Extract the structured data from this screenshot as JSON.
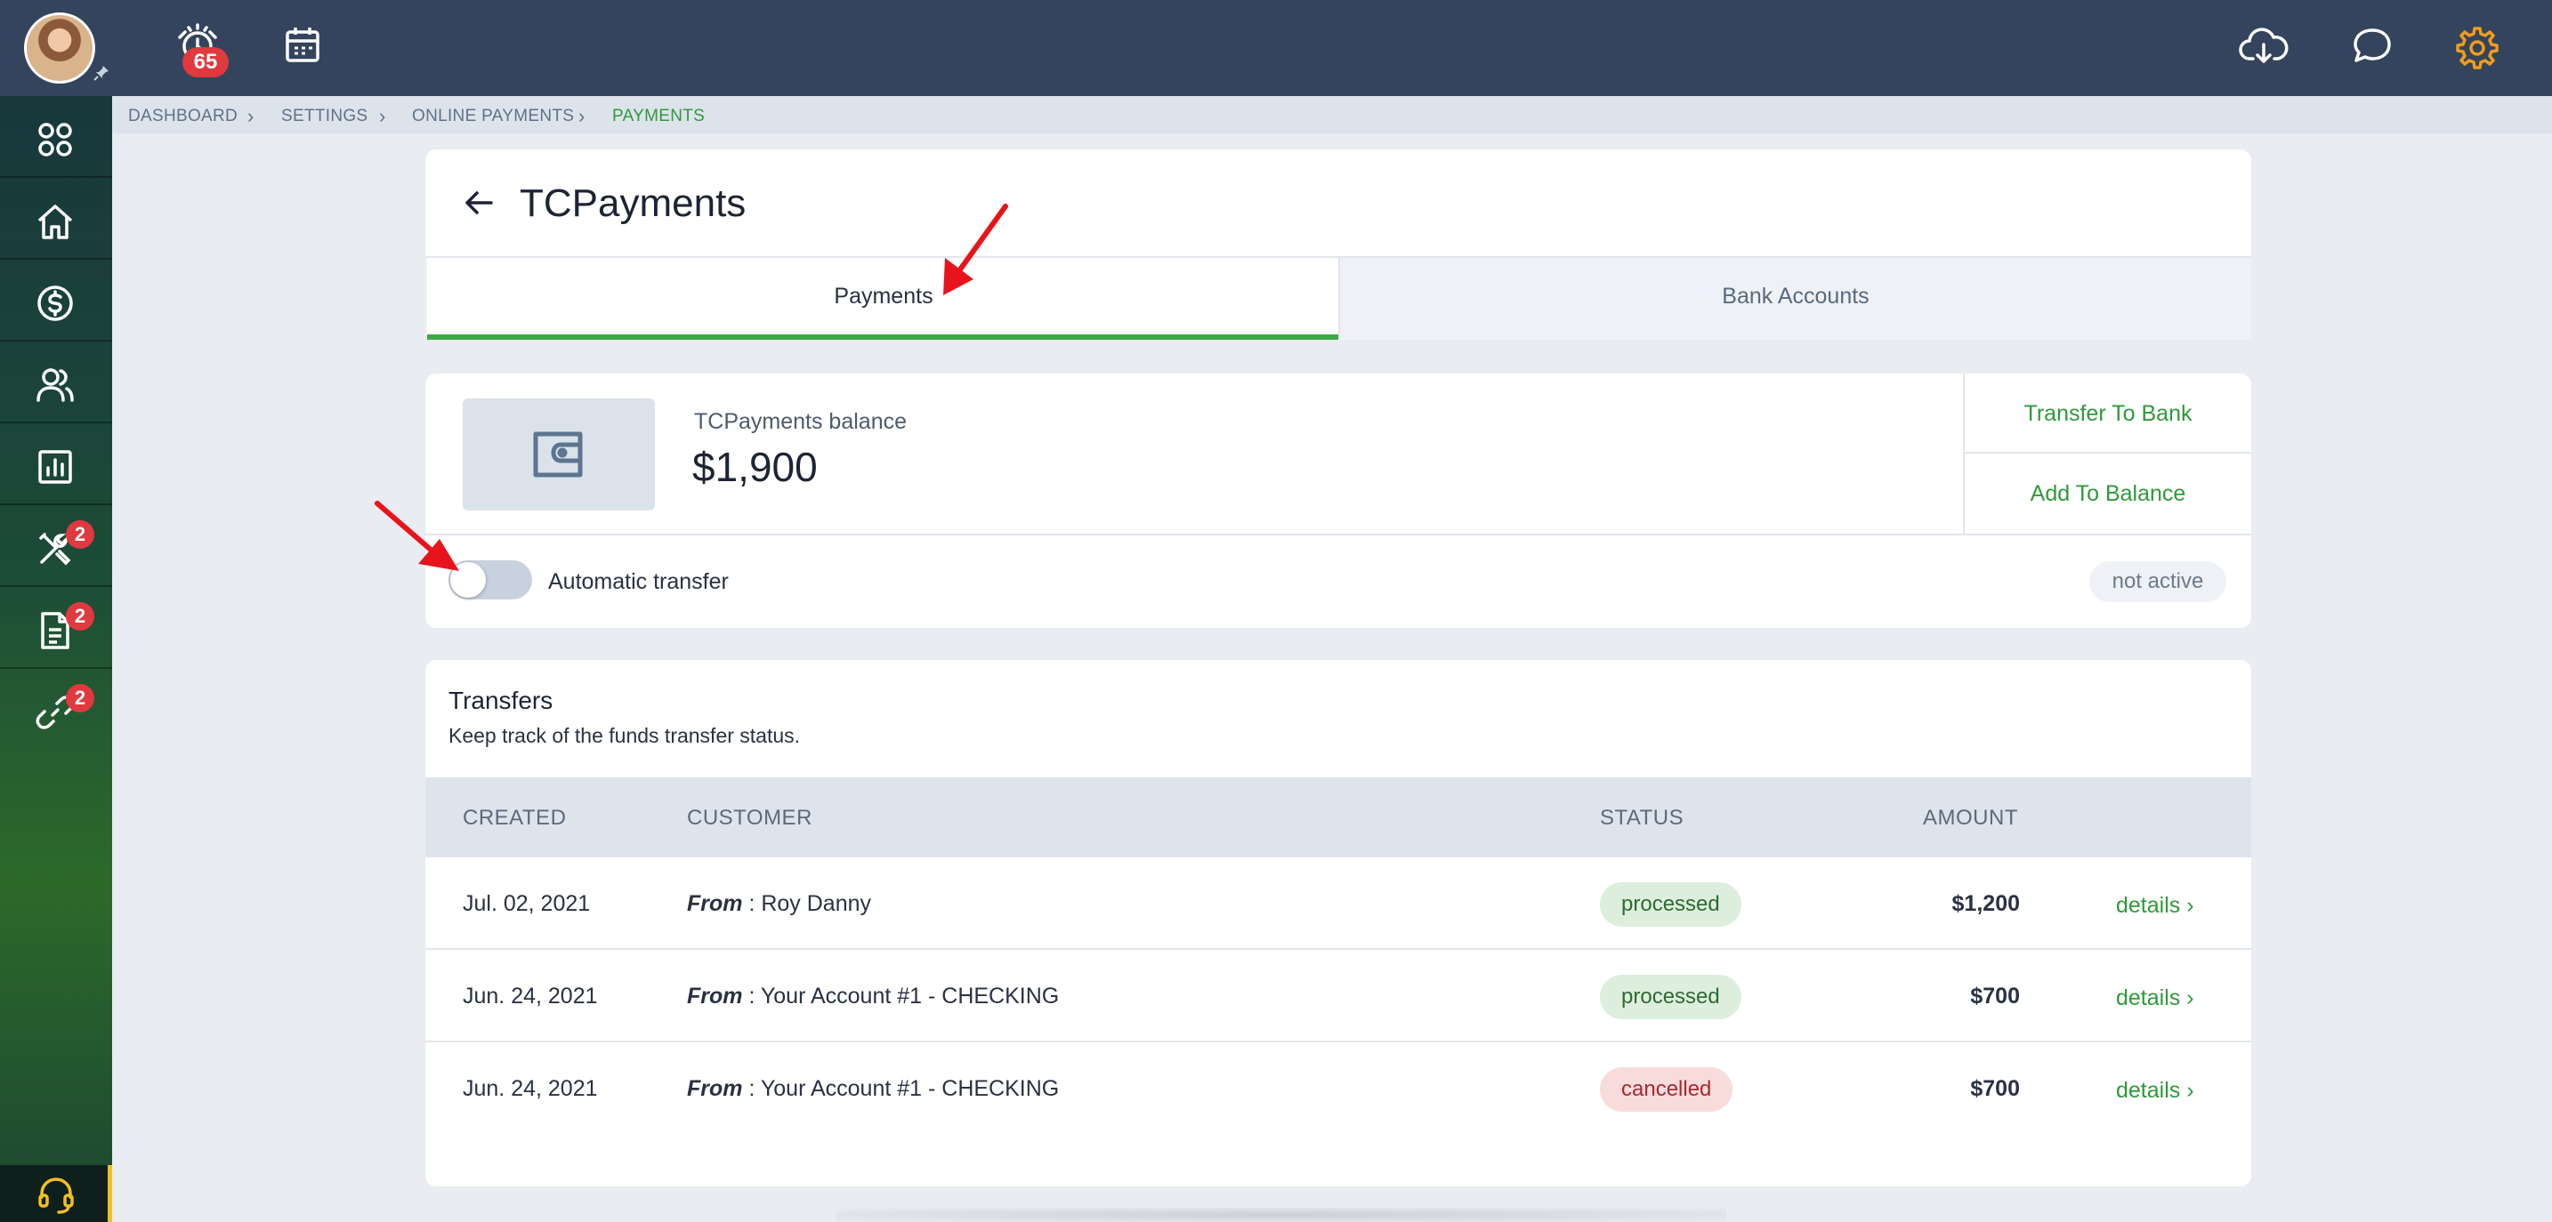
{
  "topbar": {
    "alarm_badge": "65",
    "icons": [
      "alarm-clock-icon",
      "calendar-icon",
      "cloud-download-icon",
      "chat-icon",
      "gear-icon"
    ],
    "accent_gear_color": "#f29b1d"
  },
  "sidebar": {
    "items": [
      {
        "name": "apps-grid-icon"
      },
      {
        "name": "home-icon"
      },
      {
        "name": "dollar-icon"
      },
      {
        "name": "users-icon"
      },
      {
        "name": "reports-icon"
      },
      {
        "name": "tools-icon",
        "badge": "2"
      },
      {
        "name": "document-icon",
        "badge": "2"
      },
      {
        "name": "link-icon",
        "badge": "2"
      }
    ],
    "support_icon": "headset-icon"
  },
  "breadcrumb": {
    "items": [
      "DASHBOARD",
      "SETTINGS",
      "ONLINE PAYMENTS",
      "PAYMENTS"
    ]
  },
  "header": {
    "title": "TCPayments"
  },
  "tabs": [
    {
      "label": "Payments",
      "active": true
    },
    {
      "label": "Bank Accounts",
      "active": false
    }
  ],
  "balance": {
    "label": "TCPayments balance",
    "amount": "$1,900",
    "transfer_button": "Transfer To Bank",
    "add_button": "Add To Balance",
    "auto_transfer_label": "Automatic transfer",
    "auto_transfer_on": false,
    "auto_transfer_status": "not active"
  },
  "transfers": {
    "title": "Transfers",
    "subtitle": "Keep track of the funds transfer status.",
    "columns": [
      "CREATED",
      "CUSTOMER",
      "STATUS",
      "AMOUNT"
    ],
    "rows": [
      {
        "created": "Jul. 02, 2021",
        "from_label": "From",
        "customer": " : Roy Danny",
        "status": "processed",
        "amount": "$1,200",
        "action": "details"
      },
      {
        "created": "Jun. 24, 2021",
        "from_label": "From",
        "customer": " : Your Account #1 - CHECKING",
        "status": "processed",
        "amount": "$700",
        "action": "details"
      },
      {
        "created": "Jun. 24, 2021",
        "from_label": "From",
        "customer": " : Your Account #1 - CHECKING",
        "status": "cancelled",
        "amount": "$700",
        "action": "details"
      }
    ]
  },
  "colors": {
    "topbar": "#33445c",
    "accent_green": "#2e9a3a",
    "badge_red": "#e0393e",
    "annotation_red": "#e8141c"
  }
}
